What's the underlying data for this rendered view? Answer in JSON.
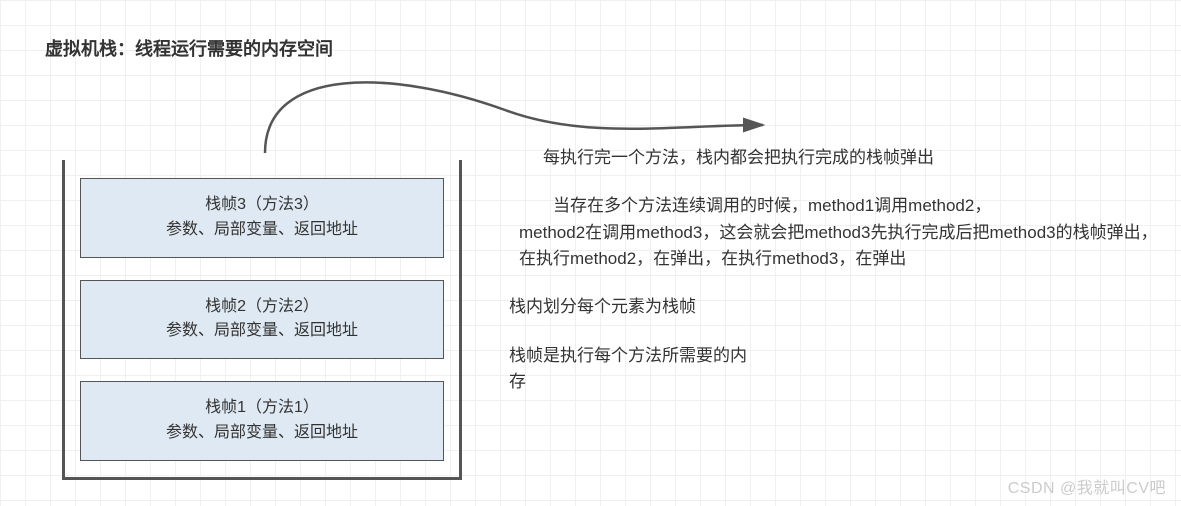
{
  "title": "虚拟机栈：线程运行需要的内存空间",
  "stack": {
    "frames": [
      {
        "name": "栈帧3（方法3）",
        "detail": "参数、局部变量、返回地址"
      },
      {
        "name": "栈帧2（方法2）",
        "detail": "参数、局部变量、返回地址"
      },
      {
        "name": "栈帧1（方法1）",
        "detail": "参数、局部变量、返回地址"
      }
    ]
  },
  "notes": {
    "p1": "每执行完一个方法，栈内都会把执行完成的栈帧弹出",
    "p2a": "当存在多个方法连续调用的时候，method1调用method2，",
    "p2b": "method2在调用method3，这会就会把method3先执行完成后把method3的栈帧弹出，在执行method2，在弹出，在执行method3，在弹出",
    "p3": "栈内划分每个元素为栈帧",
    "p4": "栈帧是执行每个方法所需要的内存"
  },
  "watermark": "CSDN @我就叫CV吧"
}
